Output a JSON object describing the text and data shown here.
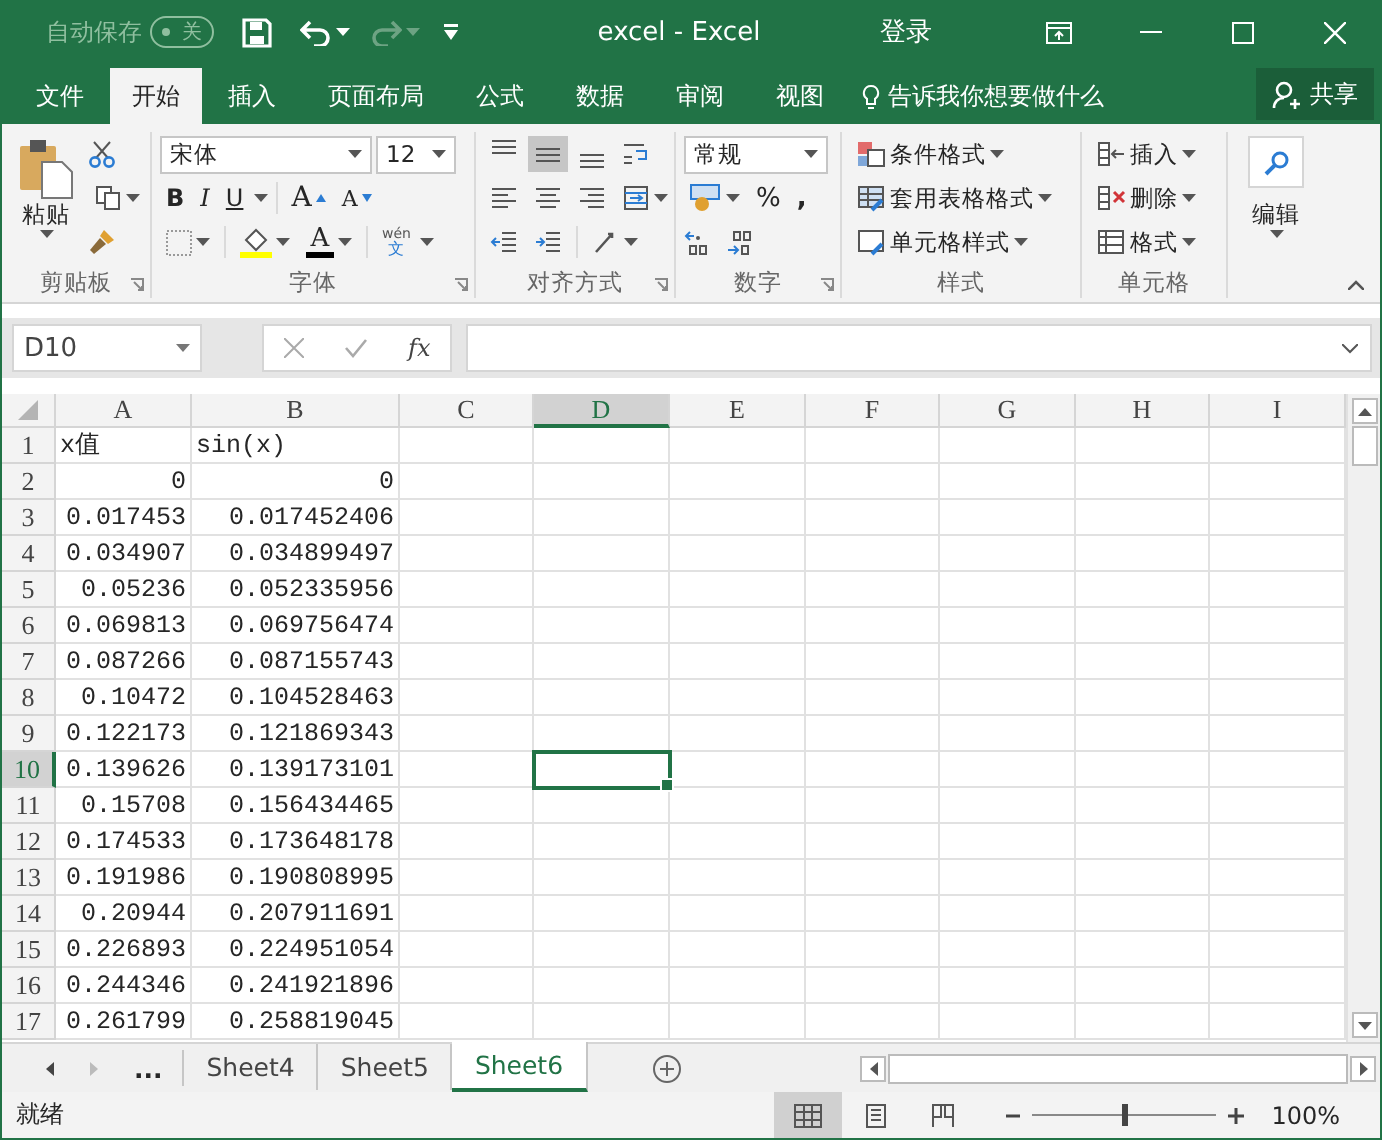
{
  "title_bar": {
    "autosave_label": "自动保存",
    "autosave_toggle": {
      "on": false,
      "label": "关"
    },
    "title": "excel  -  Excel",
    "login": "登录"
  },
  "ribbon_tabs": [
    {
      "label": "文件",
      "selected": false
    },
    {
      "label": "开始",
      "selected": true
    },
    {
      "label": "插入",
      "selected": false
    },
    {
      "label": "页面布局",
      "selected": false
    },
    {
      "label": "公式",
      "selected": false
    },
    {
      "label": "数据",
      "selected": false
    },
    {
      "label": "审阅",
      "selected": false
    },
    {
      "label": "视图",
      "selected": false
    }
  ],
  "tell_me": "告诉我你想要做什么",
  "share": "共享",
  "ribbon": {
    "clipboard": {
      "paste": "粘贴",
      "label": "剪贴板"
    },
    "font": {
      "font_name": "宋体",
      "font_size": "12",
      "style_buttons": [
        {
          "label": "B",
          "kind": "bold"
        },
        {
          "label": "I",
          "kind": "italic"
        },
        {
          "label": "U",
          "kind": "underline"
        }
      ],
      "size_buttons": [
        {
          "label": "A",
          "kind": "grow"
        },
        {
          "label": "A",
          "kind": "shrink"
        }
      ],
      "font_color": "A",
      "phonetic": "wén",
      "phonetic_char": "文",
      "label": "字体"
    },
    "alignment": {
      "buttons": [
        {
          "kind": "top",
          "selected": false
        },
        {
          "kind": "middle",
          "selected": true
        },
        {
          "kind": "bottom",
          "selected": false
        },
        {
          "kind": "wrap",
          "selected": false
        },
        {
          "kind": "left",
          "selected": false
        },
        {
          "kind": "center",
          "selected": false
        },
        {
          "kind": "right",
          "selected": false
        },
        {
          "kind": "merge",
          "selected": false
        },
        {
          "kind": "outdent",
          "selected": false
        },
        {
          "kind": "indent",
          "selected": false
        },
        {
          "kind": "orientation",
          "selected": false
        }
      ],
      "label": "对齐方式"
    },
    "number": {
      "format": "常规",
      "percent": "%",
      "comma": ",",
      "label": "数字"
    },
    "styles": {
      "items": [
        {
          "label": "条件格式",
          "kind": "conditional"
        },
        {
          "label": "套用表格格式",
          "kind": "table"
        },
        {
          "label": "单元格样式",
          "kind": "cell"
        }
      ],
      "label": "样式"
    },
    "cells": {
      "items": [
        {
          "label": "插入",
          "kind": "insert"
        },
        {
          "label": "删除",
          "kind": "delete"
        },
        {
          "label": "格式",
          "kind": "format"
        }
      ],
      "label": "单元格"
    },
    "editing": {
      "label": "编辑"
    }
  },
  "formula_bar": {
    "name_box": "D10",
    "fx": "fx"
  },
  "columns": [
    {
      "label": "A",
      "selected": false
    },
    {
      "label": "B",
      "selected": false
    },
    {
      "label": "C",
      "selected": false
    },
    {
      "label": "D",
      "selected": true
    },
    {
      "label": "E",
      "selected": false
    },
    {
      "label": "F",
      "selected": false
    },
    {
      "label": "G",
      "selected": false
    },
    {
      "label": "H",
      "selected": false
    },
    {
      "label": "I",
      "selected": false
    }
  ],
  "rows": [
    {
      "header": "1",
      "selected": false,
      "cells": [
        {
          "value": "x值",
          "kind": "text"
        },
        {
          "value": "sin(x)",
          "kind": "text"
        }
      ]
    },
    {
      "header": "2",
      "selected": false,
      "cells": [
        {
          "value": "0",
          "kind": "number"
        },
        {
          "value": "0",
          "kind": "number"
        }
      ]
    },
    {
      "header": "3",
      "selected": false,
      "cells": [
        {
          "value": "0.017453",
          "kind": "number"
        },
        {
          "value": "0.017452406",
          "kind": "number"
        }
      ]
    },
    {
      "header": "4",
      "selected": false,
      "cells": [
        {
          "value": "0.034907",
          "kind": "number"
        },
        {
          "value": "0.034899497",
          "kind": "number"
        }
      ]
    },
    {
      "header": "5",
      "selected": false,
      "cells": [
        {
          "value": "0.05236",
          "kind": "number"
        },
        {
          "value": "0.052335956",
          "kind": "number"
        }
      ]
    },
    {
      "header": "6",
      "selected": false,
      "cells": [
        {
          "value": "0.069813",
          "kind": "number"
        },
        {
          "value": "0.069756474",
          "kind": "number"
        }
      ]
    },
    {
      "header": "7",
      "selected": false,
      "cells": [
        {
          "value": "0.087266",
          "kind": "number"
        },
        {
          "value": "0.087155743",
          "kind": "number"
        }
      ]
    },
    {
      "header": "8",
      "selected": false,
      "cells": [
        {
          "value": "0.10472",
          "kind": "number"
        },
        {
          "value": "0.104528463",
          "kind": "number"
        }
      ]
    },
    {
      "header": "9",
      "selected": false,
      "cells": [
        {
          "value": "0.122173",
          "kind": "number"
        },
        {
          "value": "0.121869343",
          "kind": "number"
        }
      ]
    },
    {
      "header": "10",
      "selected": true,
      "cells": [
        {
          "value": "0.139626",
          "kind": "number"
        },
        {
          "value": "0.139173101",
          "kind": "number"
        }
      ]
    },
    {
      "header": "11",
      "selected": false,
      "cells": [
        {
          "value": "0.15708",
          "kind": "number"
        },
        {
          "value": "0.156434465",
          "kind": "number"
        }
      ]
    },
    {
      "header": "12",
      "selected": false,
      "cells": [
        {
          "value": "0.174533",
          "kind": "number"
        },
        {
          "value": "0.173648178",
          "kind": "number"
        }
      ]
    },
    {
      "header": "13",
      "selected": false,
      "cells": [
        {
          "value": "0.191986",
          "kind": "number"
        },
        {
          "value": "0.190808995",
          "kind": "number"
        }
      ]
    },
    {
      "header": "14",
      "selected": false,
      "cells": [
        {
          "value": "0.20944",
          "kind": "number"
        },
        {
          "value": "0.207911691",
          "kind": "number"
        }
      ]
    },
    {
      "header": "15",
      "selected": false,
      "cells": [
        {
          "value": "0.226893",
          "kind": "number"
        },
        {
          "value": "0.224951054",
          "kind": "number"
        }
      ]
    },
    {
      "header": "16",
      "selected": false,
      "cells": [
        {
          "value": "0.244346",
          "kind": "number"
        },
        {
          "value": "0.241921896",
          "kind": "number"
        }
      ]
    },
    {
      "header": "17",
      "selected": false,
      "cells": [
        {
          "value": "0.261799",
          "kind": "number"
        },
        {
          "value": "0.258819045",
          "kind": "number"
        }
      ]
    }
  ],
  "sheet_tabs": {
    "more": "...",
    "tabs": [
      {
        "label": "Sheet4",
        "selected": false
      },
      {
        "label": "Sheet5",
        "selected": false
      },
      {
        "label": "Sheet6",
        "selected": true
      }
    ]
  },
  "status_bar": {
    "status": "就绪",
    "views": [
      {
        "kind": "normal",
        "selected": true
      },
      {
        "kind": "page_layout",
        "selected": false
      },
      {
        "kind": "page_break",
        "selected": false
      }
    ],
    "zoom": {
      "level": 0.5
    },
    "zoom_label": "100%"
  }
}
